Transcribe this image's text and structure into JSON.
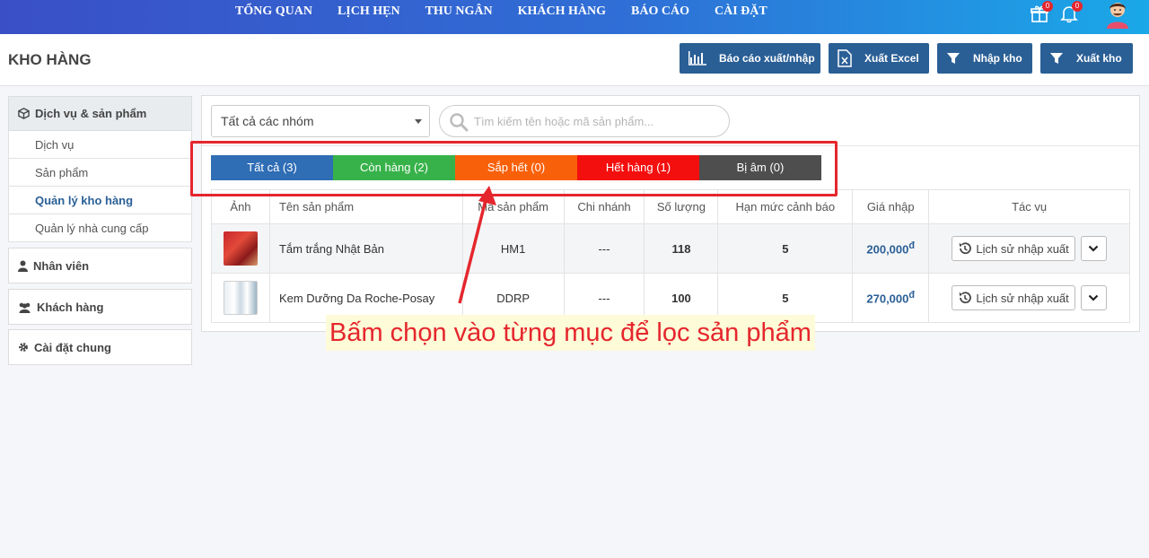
{
  "top_nav": {
    "menu": [
      "TỔNG QUAN",
      "LỊCH HẸN",
      "THU NGÂN",
      "KHÁCH HÀNG",
      "BÁO CÁO",
      "CÀI ĐẶT"
    ],
    "gift_badge": "0",
    "bell_badge": "0",
    "icons": [
      "gift-icon",
      "bell-icon",
      "user-avatar-icon"
    ]
  },
  "header": {
    "title": "KHO HÀNG",
    "buttons": {
      "report": "Báo cáo xuất/nhập",
      "excel": "Xuất Excel",
      "import": "Nhập kho",
      "export": "Xuất kho"
    }
  },
  "sidebar": {
    "section": "Dịch vụ & sản phẩm",
    "items": [
      "Dịch vụ",
      "Sản phẩm",
      "Quản lý kho hàng",
      "Quản lý nhà cung cấp"
    ],
    "active_item": "Quản lý kho hàng",
    "groups": [
      "Nhân viên",
      "Khách hàng",
      "Cài đặt chung"
    ]
  },
  "filters": {
    "group_select": "Tất cả các nhóm",
    "search_placeholder": "Tìm kiếm tên hoặc mã sản phẩm..."
  },
  "tabs": [
    {
      "label": "Tất cả (3)",
      "color": "#2f6db5"
    },
    {
      "label": "Còn hàng (2)",
      "color": "#37b24a"
    },
    {
      "label": "Sắp hết (0)",
      "color": "#f9600a"
    },
    {
      "label": "Hết hàng (1)",
      "color": "#f40f0f"
    },
    {
      "label": "Bị âm (0)",
      "color": "#4e4e4e"
    }
  ],
  "table": {
    "headers": [
      "Ảnh",
      "Tên sản phẩm",
      "Mã sản phẩm",
      "Chi nhánh",
      "Số lượng",
      "Hạn mức cảnh báo",
      "Giá nhập",
      "Tác vụ"
    ],
    "history_label": "Lịch sử nhập xuất",
    "rows": [
      {
        "name": "Tắm trắng Nhật Bản",
        "code": "HM1",
        "branch": "---",
        "qty": "118",
        "warn": "5",
        "price": "200,000",
        "currency": "đ"
      },
      {
        "name": "Kem Dưỡng Da Roche-Posay",
        "code": "DDRP",
        "branch": "---",
        "qty": "100",
        "warn": "5",
        "price": "270,000",
        "currency": "đ"
      }
    ]
  },
  "annotation": {
    "text": "Bấm chọn vào từng mục để lọc sản phẩm"
  },
  "colors": {
    "primary": "#2a5f96",
    "annotation": "#e5262d"
  }
}
